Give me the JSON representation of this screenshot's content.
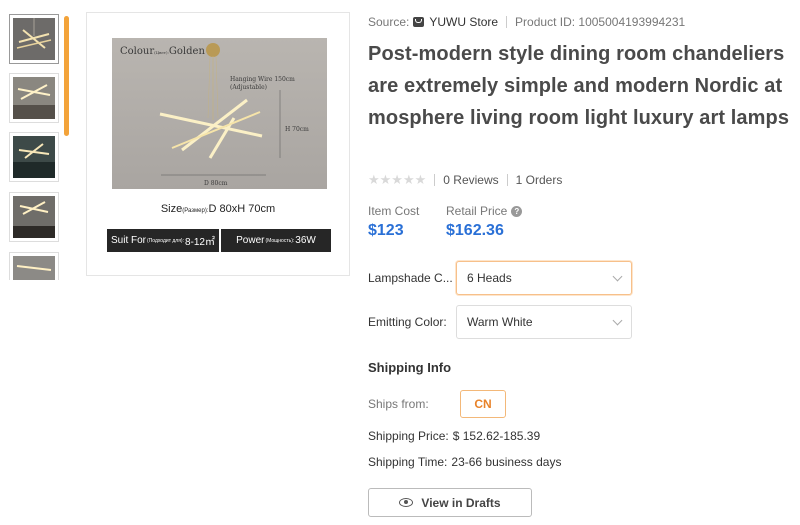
{
  "gallery": {
    "thumbnails": [
      "thumb-1",
      "thumb-2",
      "thumb-3",
      "thumb-4",
      "thumb-5"
    ],
    "main_image": {
      "colour_label": "Colour",
      "colour_small": "(Цвет):",
      "colour_value": "Golden",
      "wire_line1": "Hanging Wire 150cm",
      "wire_line2": "(Adjustable)",
      "height_label": "H 70cm",
      "diameter_label": "D 80cm",
      "size_prefix": "Size",
      "size_small": "(Размер):",
      "size_value": "D 80xH 70cm",
      "suit_prefix": "Suit For",
      "suit_small": "(Подходит для):",
      "suit_value": "8-12㎡",
      "power_prefix": "Power",
      "power_small": "(Мощность):",
      "power_value": "36W"
    }
  },
  "source": {
    "label": "Source:",
    "store": "YUWU Store",
    "product_id": "Product ID: 1005004193994231"
  },
  "product": {
    "title": "Post-modern style dining room chandeliers are extremely simple and modern Nordic atmosphere living room light luxury art lamps",
    "stars": "★★★★★",
    "reviews": "0 Reviews",
    "orders": "1 Orders"
  },
  "pricing": {
    "item_cost_label": "Item Cost",
    "item_cost": "$123",
    "retail_label": "Retail Price",
    "retail_price": "$162.36",
    "help_icon": "?"
  },
  "options": {
    "lampshade_label": "Lampshade C...",
    "lampshade_value": "6 Heads",
    "emitting_label": "Emitting Color:",
    "emitting_value": "Warm White"
  },
  "shipping": {
    "title": "Shipping Info",
    "ships_from_label": "Ships from:",
    "ships_from_value": "CN",
    "price_label": "Shipping Price:",
    "price_value": "$ 152.62-185.39",
    "time_label": "Shipping Time:",
    "time_value": "23-66 business days"
  },
  "actions": {
    "view_drafts": "View in Drafts"
  },
  "colors": {
    "price_blue": "#2a70d6",
    "accent_orange": "#f3a33a"
  }
}
